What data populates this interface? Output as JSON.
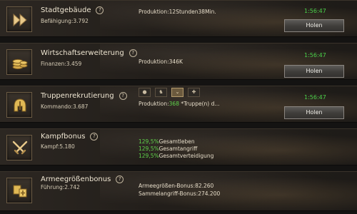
{
  "rows": [
    {
      "title": "Stadtgebäude",
      "sub": "Befähigung:3.792",
      "production_label": "Produktion:",
      "production_value": "12Stunden38Min.",
      "timer": "1:56:47",
      "button": "Holen",
      "icon": "fast-forward-icon"
    },
    {
      "title": "Wirtschaftserweiterung",
      "sub": "Finanzen:3.459",
      "production_label": "Produktion:",
      "production_value": "346K",
      "timer": "1:56:47",
      "button": "Holen",
      "icon": "coins-icon"
    },
    {
      "title": "Truppenrekrutierung",
      "sub": "Kommando:3.687",
      "production_label": "Produktion:",
      "production_value": "368",
      "production_suffix": "*Truppe(n) d...",
      "timer": "1:56:47",
      "button": "Holen",
      "icon": "helmet-icon",
      "troop_tabs": [
        "shield-tab-icon",
        "cavalry-tab-icon",
        "archer-tab-icon",
        "siege-tab-icon"
      ]
    },
    {
      "title": "Kampfbonus",
      "sub": "Kampf:5.180",
      "icon": "crossed-swords-icon",
      "bonuses": [
        {
          "pct": "129,5%",
          "label": "Gesamtleben"
        },
        {
          "pct": "129,5%",
          "label": "Gesamtangriff"
        },
        {
          "pct": "129,5%",
          "label": "Gesamtverteidigung"
        }
      ]
    },
    {
      "title": "Armeegrößenbonus",
      "sub": "Führung:2.742",
      "icon": "army-banner-icon",
      "lines": [
        "Armeegrößen-Bonus:82.260",
        "Sammelangriff-Bonus:274.200"
      ]
    }
  ],
  "help_glyph": "?"
}
